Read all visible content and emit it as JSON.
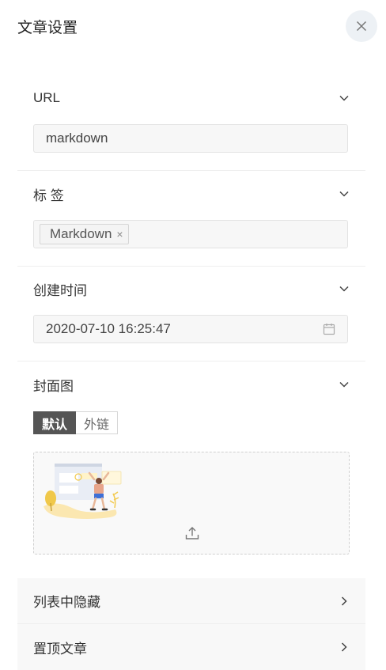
{
  "panel": {
    "title": "文章设置"
  },
  "url_section": {
    "label": "URL",
    "value": "markdown"
  },
  "tags_section": {
    "label": "标 签",
    "tags": [
      "Markdown"
    ]
  },
  "created_section": {
    "label": "创建时间",
    "value": "2020-07-10 16:25:47"
  },
  "cover_section": {
    "label": "封面图",
    "options": [
      "默认",
      "外链"
    ],
    "selected": "默认"
  },
  "rows": [
    {
      "label": "列表中隐藏"
    },
    {
      "label": "置顶文章"
    }
  ],
  "colors": {
    "accent": "#555555",
    "field_bg": "#f7f7f7",
    "close_bg": "#edf1f5"
  },
  "icons": [
    "close-icon",
    "chevron-down-icon",
    "calendar-icon",
    "upload-icon",
    "chevron-right-icon"
  ]
}
